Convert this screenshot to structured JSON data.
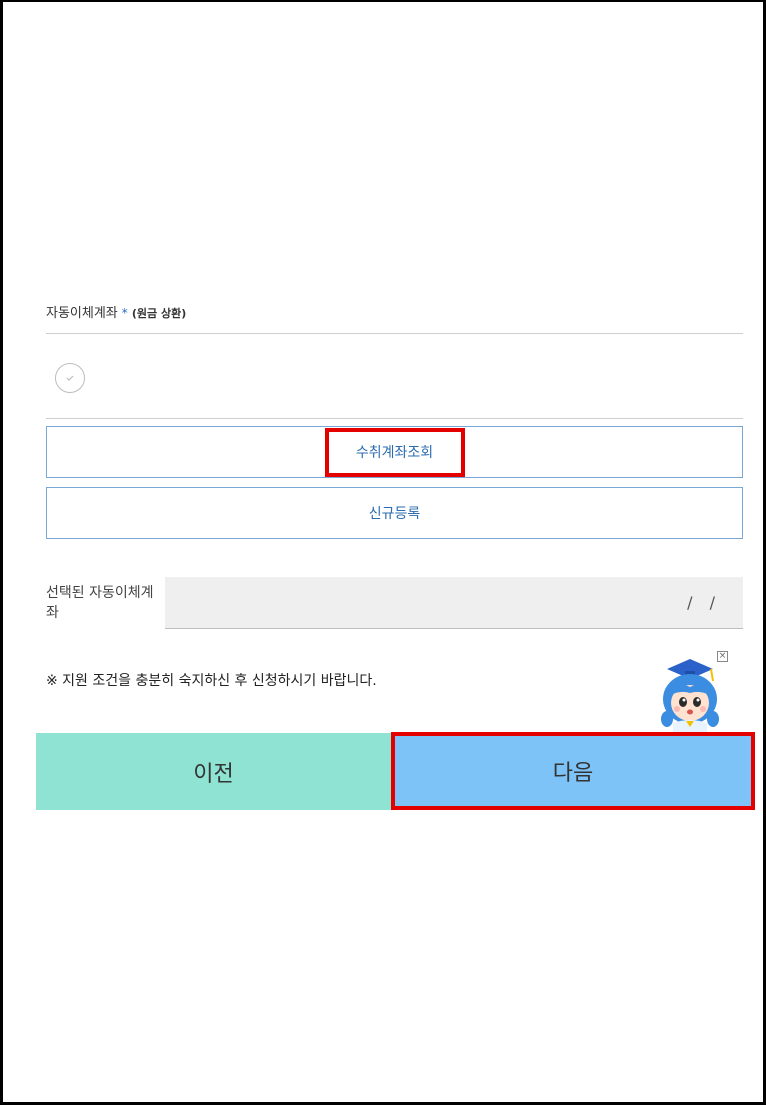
{
  "account_section": {
    "title": "자동이체계좌",
    "required_mark": "*",
    "subtitle": "(원금 상환)"
  },
  "buttons": {
    "lookup_label": "수취계좌조회",
    "register_label": "신규등록",
    "prev_label": "이전",
    "next_label": "다음"
  },
  "selected_account": {
    "label": "선택된 자동이체계좌",
    "value": "/ /"
  },
  "notice": {
    "text": "※ 지원 조건을 충분히 숙지하신 후 신청하시기 바랍니다."
  },
  "colors": {
    "prev_button": "#8fe3d2",
    "next_button": "#7dc3f7",
    "highlight": "#e50000",
    "link_blue": "#2b6cb0"
  },
  "icons": {
    "check": "check-icon",
    "mascot": "mascot-icon",
    "close": "close-icon"
  }
}
